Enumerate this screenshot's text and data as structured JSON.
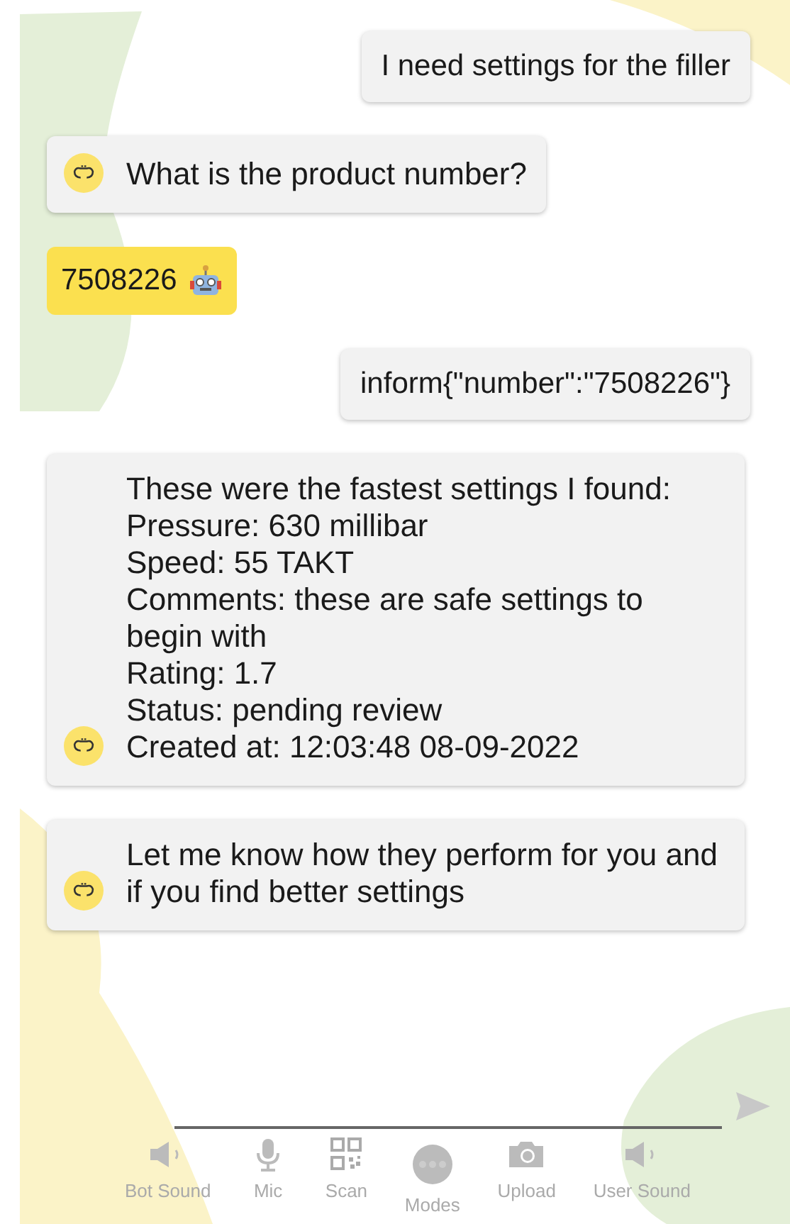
{
  "messages": [
    {
      "kind": "user",
      "text": "I need settings for the filler"
    },
    {
      "kind": "bot",
      "text": "What is the product number?"
    },
    {
      "kind": "quick_reply",
      "text": "7508226"
    },
    {
      "kind": "user",
      "text": "inform{\"number\":\"7508226\"}"
    },
    {
      "kind": "bot",
      "text": "These were the fastest settings I found:\n Pressure: 630 millibar\n Speed: 55 TAKT\n Comments: these are safe settings to begin with\n Rating: 1.7\n Status: pending review\n Created at: 12:03:48 08-09-2022"
    },
    {
      "kind": "bot",
      "text": "Let me know how they perform for you and if you find better settings"
    }
  ],
  "toolbar": [
    {
      "kind": "speaker",
      "label": "Bot Sound"
    },
    {
      "kind": "mic",
      "label": "Mic"
    },
    {
      "kind": "qr",
      "label": "Scan"
    },
    {
      "kind": "modes",
      "label": "Modes"
    },
    {
      "kind": "camera",
      "label": "Upload"
    },
    {
      "kind": "speaker",
      "label": "User Sound"
    }
  ]
}
